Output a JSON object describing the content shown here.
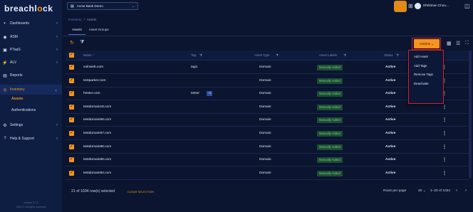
{
  "brand": {
    "prefix": "breachl",
    "o": "o",
    "suffix": "ck"
  },
  "sidebar": {
    "items": [
      {
        "label": "Dashboards",
        "icon": "dashboard-icon",
        "glyph": "◐",
        "chevron": "›"
      },
      {
        "label": "ASM",
        "icon": "asm-icon",
        "glyph": "◉",
        "chevron": "›"
      },
      {
        "label": "PTaaS",
        "icon": "ptaas-icon",
        "glyph": "▣",
        "chevron": "›"
      },
      {
        "label": "ALV",
        "icon": "alv-icon",
        "glyph": "⚡",
        "chevron": "›"
      },
      {
        "label": "Reports",
        "icon": "reports-icon",
        "glyph": "▤",
        "chevron": ""
      },
      {
        "label": "Inventory",
        "icon": "inventory-icon",
        "glyph": "◎",
        "chevron": "⌄"
      },
      {
        "label": "Settings",
        "icon": "settings-icon",
        "glyph": "⚙",
        "chevron": "›"
      },
      {
        "label": "Help & Support",
        "icon": "help-icon",
        "glyph": "?",
        "chevron": "›"
      }
    ],
    "sub_items": [
      {
        "label": "Assets"
      },
      {
        "label": "Authentications"
      }
    ],
    "version_lines": [
      "version 3.7.0",
      "2024 © All rights reserved"
    ]
  },
  "topbar": {
    "org": "Acme Bank Demo",
    "org_icon": "▤",
    "user": "Dhritiman Chou...",
    "icons": {
      "grid": "⊞",
      "chat": "◫"
    }
  },
  "breadcrumb": {
    "parent": "Inventory",
    "sep": "/",
    "current": "Assets"
  },
  "tabs": [
    "Assets",
    "Asset Groups"
  ],
  "toolbar": {
    "refresh": "↻",
    "filter": "⧩",
    "actions_label": "Actions",
    "actions_caret": "⌄",
    "view_grid": "▦",
    "view_list": "☰",
    "expand": "⛶"
  },
  "table": {
    "headers": [
      "Name ↑",
      "Tag",
      "Asset Type",
      "Asset Labels",
      "Status"
    ],
    "header_icons": {
      "filter": "⧩",
      "sort": "↓"
    },
    "rows": [
      {
        "name": "vulnweb.com",
        "tag": "tag1",
        "tag_chip": "",
        "type": "Domain",
        "label": "Manually Added",
        "status": "Active"
      },
      {
        "name": "testparker.com",
        "tag": "",
        "tag_chip": "",
        "type": "Domain",
        "label": "Manually Added",
        "status": "Active"
      },
      {
        "name": "hester.com",
        "tag": "tetser",
        "tag_chip": "+3",
        "type": "Domain",
        "label": "Manually Added",
        "status": "Active"
      },
      {
        "name": "testdomain18.com",
        "tag": "",
        "tag_chip": "",
        "type": "Domain",
        "label": "Manually Added",
        "status": "Active"
      },
      {
        "name": "testdomain58.com",
        "tag": "",
        "tag_chip": "",
        "type": "Domain",
        "label": "Manually Added",
        "status": "Active"
      },
      {
        "name": "testdomain67.com",
        "tag": "",
        "tag_chip": "",
        "type": "Domain",
        "label": "Manually Added",
        "status": "Active"
      },
      {
        "name": "testdomain88.com",
        "tag": "",
        "tag_chip": "",
        "type": "Domain",
        "label": "Manually Added",
        "status": "Active"
      },
      {
        "name": "testdomain96.com",
        "tag": "",
        "tag_chip": "",
        "type": "Domain",
        "label": "Manually Added",
        "status": "Active"
      },
      {
        "name": "testdomain84.com",
        "tag": "",
        "tag_chip": "",
        "type": "Domain",
        "label": "Manually Added",
        "status": "Active"
      }
    ]
  },
  "actions_menu": [
    "Add Asset",
    "Add Tags",
    "Remove Tags",
    "Deactivate"
  ],
  "footer": {
    "selected": "21 of 1034 row(s) selected",
    "clear": "CLEAR SELECTION",
    "rows_per_page_label": "Rows per page",
    "rows_per_page_value": "20 ⌄",
    "range": "1–20 of 1034",
    "prev": "‹",
    "next": "›"
  },
  "colors": {
    "accent": "#f7941d",
    "sidebar": "#0e1d42",
    "background": "#0b1530",
    "label_badge": "#1f4d33",
    "highlight_outline": "#d81e2a"
  }
}
